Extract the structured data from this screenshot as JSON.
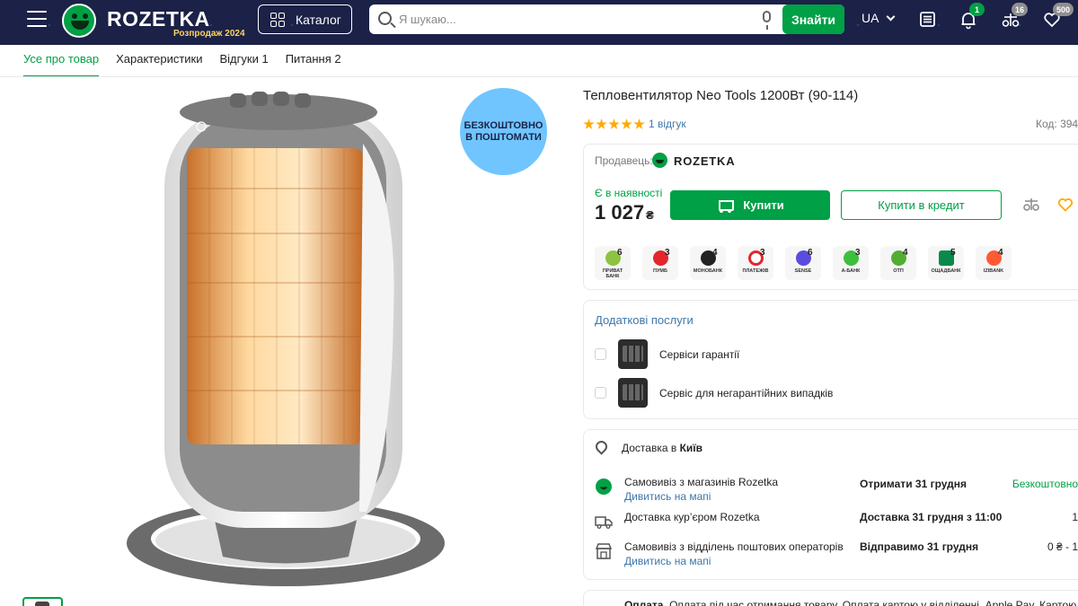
{
  "header": {
    "logo_text": "ROZETKA",
    "logo_sub": "Розпродаж 2024",
    "catalog_label": "Каталог",
    "search_placeholder": "Я шукаю...",
    "search_button": "Знайти",
    "language": "UA",
    "notifications_count": "1",
    "compare_count": "16",
    "wishlist_count": "500",
    "brand_color": "#00a046"
  },
  "tabs": [
    {
      "label": "Усе про товар",
      "active": true
    },
    {
      "label": "Характеристики",
      "active": false
    },
    {
      "label": "Відгуки 1",
      "active": false
    },
    {
      "label": "Питання 2",
      "active": false
    }
  ],
  "promo_badge": "БЕЗКОШТОВНО В ПОШТОМАТИ",
  "product": {
    "title": "Тепловентилятор Neo Tools 1200Вт (90-114)",
    "rating_stars": 5,
    "reviews_link": "1 відгук",
    "code": "Код: 394",
    "seller_label": "Продавець:",
    "seller_name": "ROZETKA",
    "availability": "Є в наявності",
    "price": "1 027",
    "currency": "₴",
    "buy_label": "Купити",
    "credit_label": "Купити в кредит"
  },
  "banks": [
    {
      "name": "ПРИВАТ БАНК",
      "count": "6",
      "color": "#8cc43f"
    },
    {
      "name": "ПУМБ",
      "count": "3",
      "color": "#e3262d"
    },
    {
      "name": "МОНОБАНК",
      "count": "4",
      "color": "#222222"
    },
    {
      "name": "ПЛАТЕЖІВ",
      "count": "3",
      "color": "#e3262d"
    },
    {
      "name": "SENSE",
      "count": "6",
      "color": "#5b4ce0"
    },
    {
      "name": "А-БАНК",
      "count": "3",
      "color": "#3dbf3d"
    },
    {
      "name": "ОТП",
      "count": "4",
      "color": "#52ae32"
    },
    {
      "name": "ОЩАДБАНК",
      "count": "5",
      "color": "#0a8a4a"
    },
    {
      "name": "IZIBANK",
      "count": "4",
      "color": "#ff5a36"
    }
  ],
  "services": {
    "title": "Додаткові послуги",
    "items": [
      {
        "label": "Сервіси гарантії"
      },
      {
        "label": "Сервіс для негарантійних випадків"
      }
    ]
  },
  "delivery": {
    "label": "Доставка в",
    "city": "Київ",
    "options": [
      {
        "name": "Самовивіз з магазинів Rozetka",
        "link": "Дивитись на мапі",
        "when": "Отримати 31 грудня",
        "price": "Безкоштовно"
      },
      {
        "name": "Доставка кур’єром Rozetka",
        "link": "",
        "when": "Доставка 31 грудня з 11:00",
        "price": "1"
      },
      {
        "name": "Самовивіз з відділень поштових операторів",
        "link": "Дивитись на мапі",
        "when": "Відправимо 31 грудня",
        "price": "0 ₴ - 1"
      }
    ]
  },
  "payment": {
    "label": "Оплата.",
    "text": "Оплата під час отримання товару, Оплата картою у відділенні, Apple Pay, Картою"
  }
}
